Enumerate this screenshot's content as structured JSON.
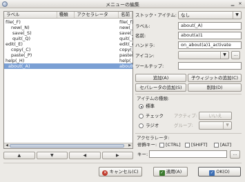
{
  "window": {
    "title": "メニューの編集"
  },
  "tree": {
    "columns": [
      "ラベル",
      "種類",
      "アクセラレータ",
      "名前"
    ],
    "rows": [
      {
        "label": "file(_F)",
        "name": "file(_f)",
        "selected": false
      },
      {
        "label": "new(_N)",
        "name": "new(_n)",
        "selected": false
      },
      {
        "label": "save(_S)",
        "name": "save(_s)",
        "selected": false
      },
      {
        "label": "quit(_Q)",
        "name": "quit(_q)",
        "selected": false
      },
      {
        "label": "edit(_E)",
        "name": "edit(_e)",
        "selected": false
      },
      {
        "label": "copy(_C)",
        "name": "copy(_c)",
        "selected": false
      },
      {
        "label": "paste(_P)",
        "name": "paste(_p)",
        "selected": false
      },
      {
        "label": "help(_H)",
        "name": "help(_h)",
        "selected": false
      },
      {
        "label": "about(_A)",
        "name": "about(_a)",
        "selected": true
      }
    ],
    "move_buttons": [
      "▲",
      "▼",
      "◀",
      "▶"
    ]
  },
  "form": {
    "stock_label": "ストック・アイテム:",
    "stock_value": "なし",
    "label_label": "ラベル:",
    "label_value": "about(_A)",
    "name_label": "名前:",
    "name_value": "about(a)1",
    "handler_label": "ハンドラ:",
    "handler_value": "on_about(a)1_activate",
    "icon_label": "アイコン:",
    "icon_value": "",
    "icon_browse": "...",
    "tooltip_label": "ツールチップ:",
    "tooltip_value": "",
    "add_button": "追加(A)",
    "add_child_button": "子ウィジットの追加(C)",
    "add_separator_button": "セパレータの追加(S)",
    "delete_button": "削除(D)"
  },
  "item_type": {
    "title": "アイテムの種類:",
    "standard": "標準",
    "check": "チェック",
    "radio": "ラジオ",
    "active_label": "アクティブ:",
    "active_value": "いいえ",
    "group_label": "グループ:",
    "group_value": ""
  },
  "accelerator": {
    "title": "アクセラレータ:",
    "modifier_label": "修飾キー:",
    "ctrl": "[CTRL]",
    "shift": "[SHIFT]",
    "alt": "[ALT]",
    "key_label": "キー:",
    "key_value": "",
    "key_browse": "..."
  },
  "dialog": {
    "cancel": "キャンセル(C)",
    "apply": "適用(A)",
    "ok": "OK(O)"
  }
}
